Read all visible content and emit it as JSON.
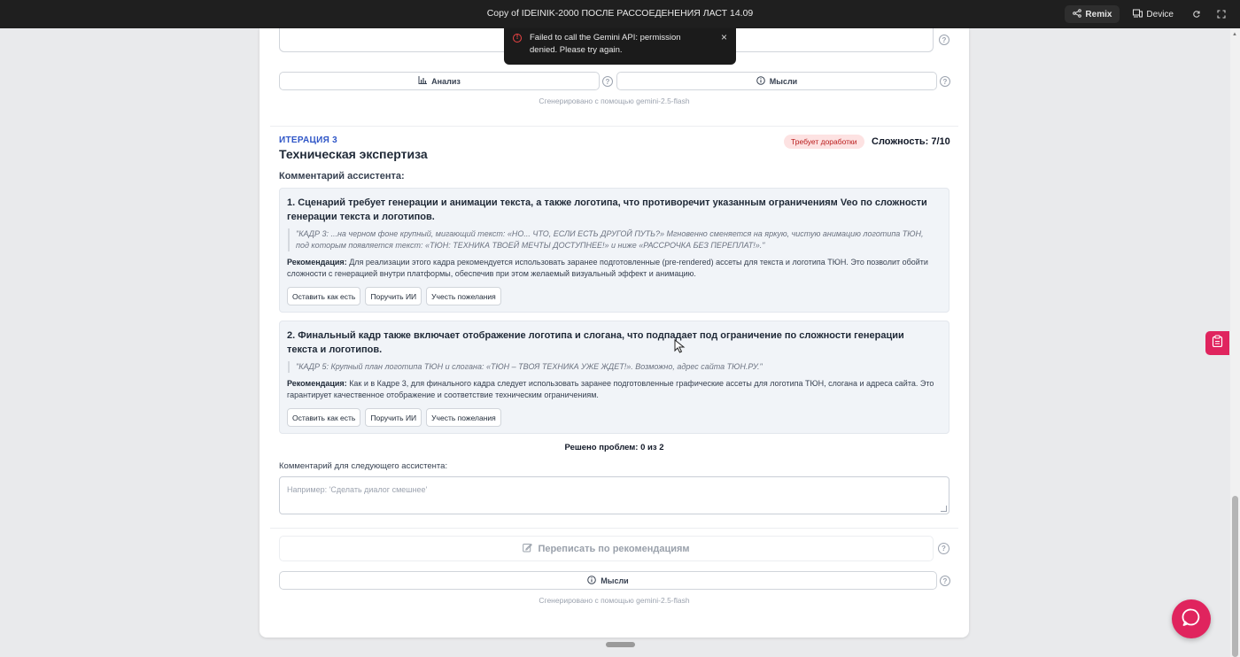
{
  "topbar": {
    "title": "Copy of IDEINIK-2000 ПОСЛЕ РАССОЕДЕНЕНИЯ ЛАСТ 14.09",
    "remix_label": "Remix",
    "device_label": "Device"
  },
  "toast": {
    "message": "Failed to call the Gemini API: permission denied. Please try again."
  },
  "prev_section": {
    "analysis_label": "Анализ",
    "thoughts_label": "Мысли",
    "generated_note": "Сгенерировано с помощью gemini-2.5-flash"
  },
  "iteration": {
    "label": "ИТЕРАЦИЯ 3",
    "title": "Техническая экспертиза",
    "status_badge": "Требует доработки",
    "complexity": "Сложность: 7/10",
    "assistant_comment_heading": "Комментарий ассистента:"
  },
  "issues": [
    {
      "title": "1. Сценарий требует генерации и анимации текста, а также логотипа, что противоречит указанным ограничениям Veo по сложности генерации текста и логотипов.",
      "quote": "\"КАДР 3: ...на черном фоне крупный, мигающий текст: «НО... ЧТО, ЕСЛИ ЕСТЬ ДРУГОЙ ПУТЬ?» Мгновенно сменяется на яркую, чистую анимацию логотипа ТЮН, под которым появляется текст: «ТЮН: ТЕХНИКА ТВОЕЙ МЕЧТЫ ДОСТУПНЕЕ!» и ниже «РАССРОЧКА БЕЗ ПЕРЕПЛАТ!».\"",
      "rec_label": "Рекомендация:",
      "rec_text": " Для реализации этого кадра рекомендуется использовать заранее подготовленные (pre-rendered) ассеты для текста и логотипа ТЮН. Это позволит обойти сложности с генерацией внутри платформы, обеспечив при этом желаемый визуальный эффект и анимацию."
    },
    {
      "title": "2. Финальный кадр также включает отображение логотипа и слогана, что подпадает под ограничение по сложности генерации текста и логотипов.",
      "quote": "\"КАДР 5: Крупный план логотипа ТЮН и слогана: «ТЮН – ТВОЯ ТЕХНИКА УЖЕ ЖДЕТ!». Возможно, адрес сайта ТЮН.РУ.\"",
      "rec_label": "Рекомендация:",
      "rec_text": " Как и в Кадре 3, для финального кадра следует использовать заранее подготовленные графические ассеты для логотипа ТЮН, слогана и адреса сайта. Это гарантирует качественное отображение и соответствие техническим ограничениям."
    }
  ],
  "options": {
    "keep": "Оставить как есть",
    "delegate": "Поручить ИИ",
    "consider": "Учесть пожелания"
  },
  "summary": {
    "solved": "Решено проблем: 0 из 2",
    "next_comment_label": "Комментарий для следующего ассистента:",
    "next_comment_placeholder": "Например: 'Сделать диалог смешнее'"
  },
  "bottom": {
    "rewrite_label": "Переписать по рекомендациям",
    "thoughts_label": "Мысли",
    "generated_note": "Сгенерировано с помощью gemini-2.5-flash"
  },
  "colors": {
    "accent_pink": "#e0245e",
    "iteration_blue": "#2f56c7",
    "badge_bg": "#fde2e2",
    "badge_text": "#b91c1c"
  }
}
